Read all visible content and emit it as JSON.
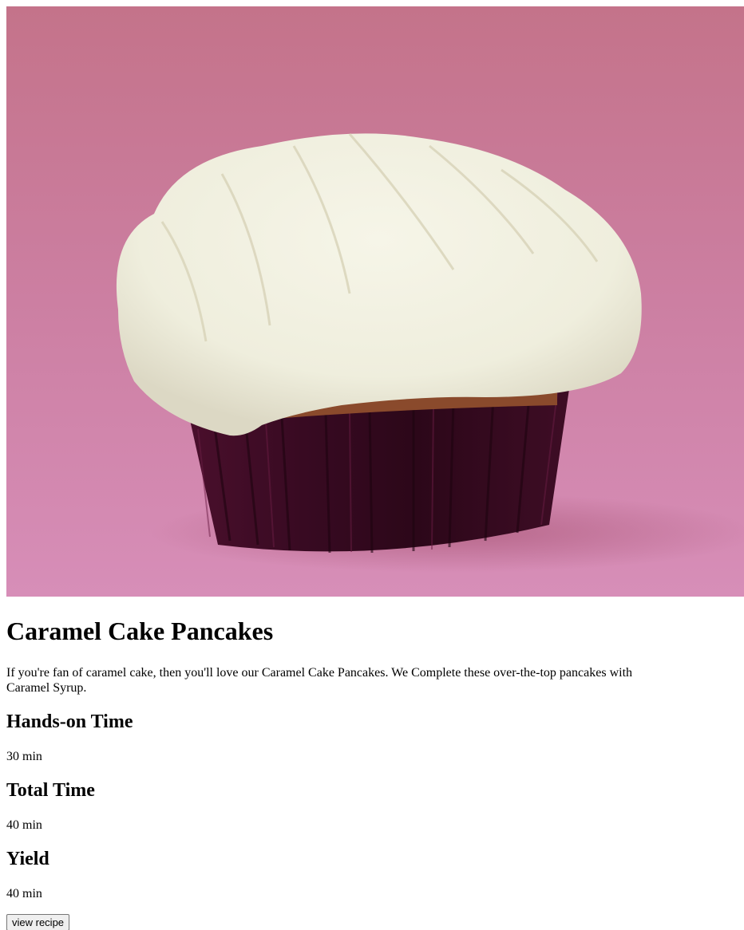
{
  "hero_image": {
    "icon": "cupcake-photo"
  },
  "recipe": {
    "title": "Caramel Cake Pancakes",
    "description": "If you're fan of caramel cake, then you'll love our Caramel Cake Pancakes. We Complete these over-the-top pancakes with Caramel Syrup.",
    "hands_on_label": "Hands-on Time",
    "hands_on_value": "30 min",
    "total_label": "Total Time",
    "total_value": "40 min",
    "yield_label": "Yield",
    "yield_value": "40 min",
    "button_label": "view recipe"
  },
  "colors": {
    "background": "#c97a99",
    "frosting": "#f1efe0",
    "liner": "#3d0b26"
  }
}
